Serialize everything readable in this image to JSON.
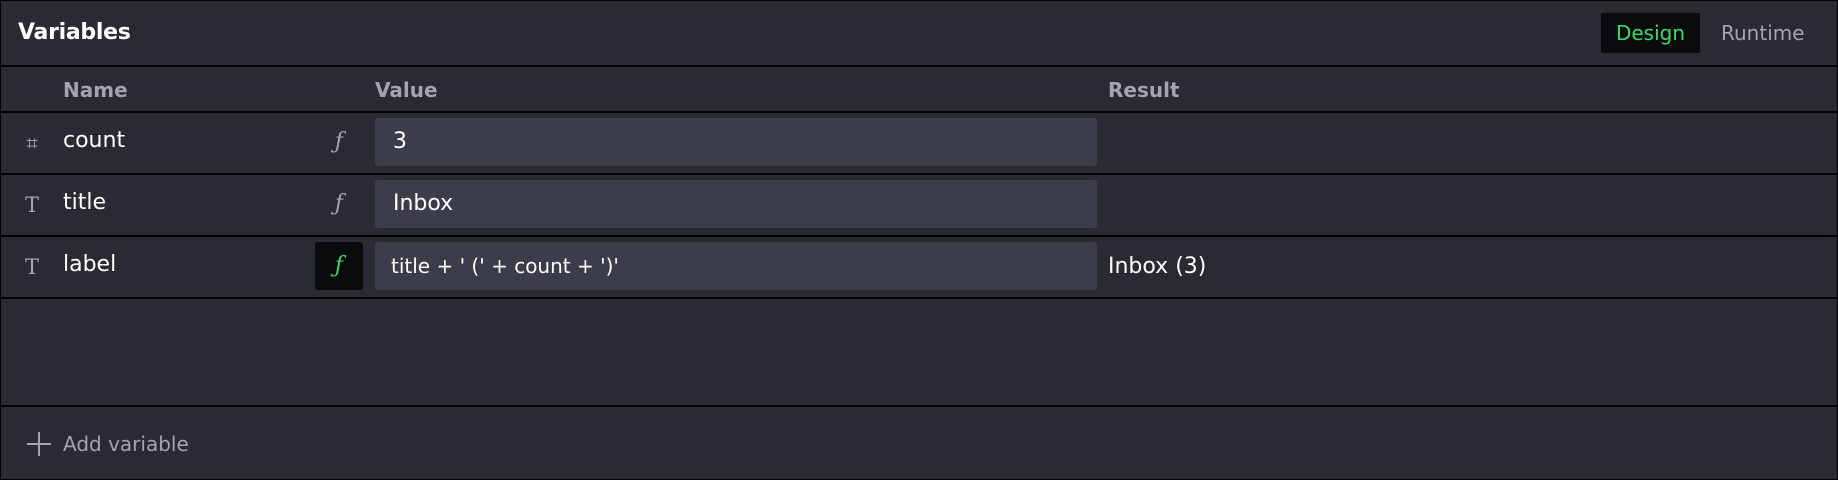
{
  "panel": {
    "title": "Variables"
  },
  "mode": {
    "design_label": "Design",
    "runtime_label": "Runtime",
    "active": "Design"
  },
  "columns": {
    "name": "Name",
    "value": "Value",
    "result": "Result"
  },
  "variables": [
    {
      "type_icon": "hash-icon",
      "type_glyph": "⌗",
      "name": "count",
      "fx_glyph": "ƒ",
      "is_expression": false,
      "value": "3",
      "result": ""
    },
    {
      "type_icon": "text-type-icon",
      "type_glyph": "T",
      "name": "title",
      "fx_glyph": "ƒ",
      "is_expression": false,
      "value": "Inbox",
      "result": ""
    },
    {
      "type_icon": "text-type-icon",
      "type_glyph": "T",
      "name": "label",
      "fx_glyph": "ƒ",
      "is_expression": true,
      "value": "title + ' (' + count + ')'",
      "result": "Inbox (3)"
    }
  ],
  "footer": {
    "add_label": "Add variable"
  },
  "colors": {
    "background": "#2a2a33",
    "field_background": "#3c3d4a",
    "accent_green": "#3dd968",
    "muted_text": "#a2a4ae",
    "divider": "#000000"
  }
}
